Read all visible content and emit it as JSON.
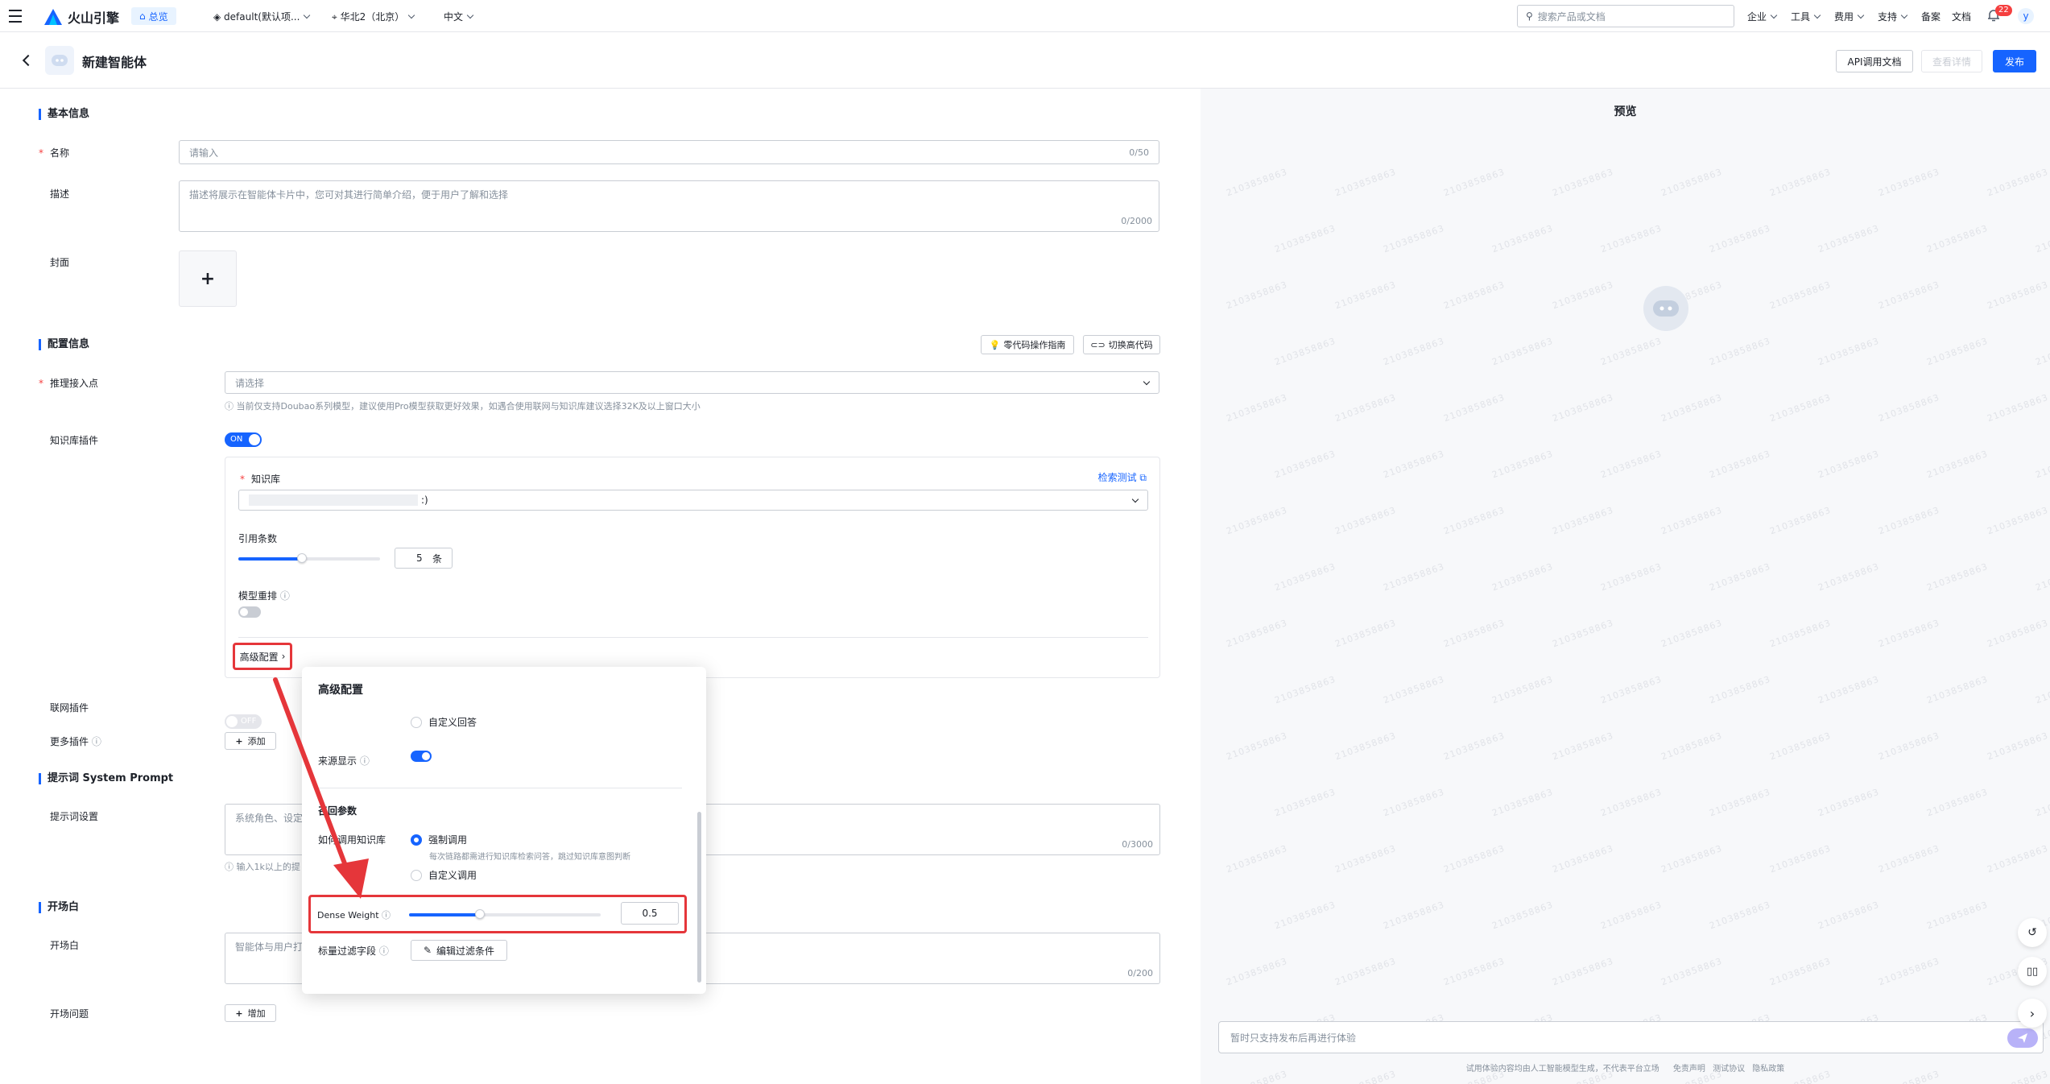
{
  "topbar": {
    "brand": "火山引擎",
    "home_tab": "总览",
    "project": "default(默认项...",
    "region": "华北2（北京）",
    "language": "中文",
    "search_placeholder": "搜索产品或文档",
    "nav": [
      "企业",
      "工具",
      "费用",
      "支持",
      "备案",
      "文档"
    ],
    "notifications": "22",
    "avatar": "y"
  },
  "header": {
    "title": "新建智能体",
    "api_doc": "API调用文档",
    "view_detail": "查看详情",
    "publish": "发布"
  },
  "basic": {
    "section": "基本信息",
    "name_label": "名称",
    "name_placeholder": "请输入",
    "name_counter": "0/50",
    "desc_label": "描述",
    "desc_placeholder": "描述将展示在智能体卡片中，您可对其进行简单介绍，便于用户了解和选择",
    "desc_counter": "0/2000",
    "cover_label": "封面",
    "cover_plus": "+"
  },
  "config": {
    "section": "配置信息",
    "guide_btn": "零代码操作指南",
    "switch_btn": "切换高代码",
    "endpoint_label": "推理接入点",
    "endpoint_placeholder": "请选择",
    "endpoint_hint": "当前仅支持Doubao系列模型，建议使用Pro模型获取更好效果，如遇合使用联网与知识库建议选择32K及以上窗口大小",
    "kb_plugin_label": "知识库插件",
    "kb_toggle": "ON",
    "kb_label": "知识库",
    "kb_test": "检索测试",
    "kb_value": ":)",
    "cite_label": "引用条数",
    "cite_value": "5",
    "cite_unit": "条",
    "cite_level": 0.45,
    "rerank_label": "模型重排",
    "advanced_label": "高级配置",
    "web_plugin_label": "联网插件",
    "web_toggle": "OFF",
    "more_plugins_label": "更多插件",
    "add_btn": "添加"
  },
  "prompt": {
    "section": "提示词 System Prompt",
    "label": "提示词设置",
    "placeholder": "系统角色、设定",
    "counter": "0/3000",
    "hint": "输入1k以上的提"
  },
  "opening": {
    "section": "开场白",
    "label": "开场白",
    "placeholder": "智能体与用户打",
    "counter": "0/200",
    "questions_label": "开场问题",
    "add_btn": "增加"
  },
  "popup": {
    "title": "高级配置",
    "custom_answer": "自定义回答",
    "source_label": "来源显示",
    "params_title": "召回参数",
    "how_label": "如何调用知识库",
    "force_call": "强制调用",
    "force_desc": "每次链路都需进行知识库检索问答，跳过知识库意图判断",
    "custom_call": "自定义调用",
    "dense_label": "Dense Weight",
    "dense_value": "0.5",
    "dense_level": 0.37,
    "filter_label": "标量过滤字段",
    "filter_btn": "编辑过滤条件"
  },
  "preview": {
    "title": "预览",
    "input_placeholder": "暂时只支持发布后再进行体验",
    "footer": "试用体验内容均由人工智能模型生成，不代表平台立场",
    "links": [
      "免责声明",
      "测试协议",
      "隐私政策"
    ],
    "watermark": "2103858863"
  },
  "colors": {
    "accent": "#1664ff",
    "highlight": "#e5363a"
  }
}
